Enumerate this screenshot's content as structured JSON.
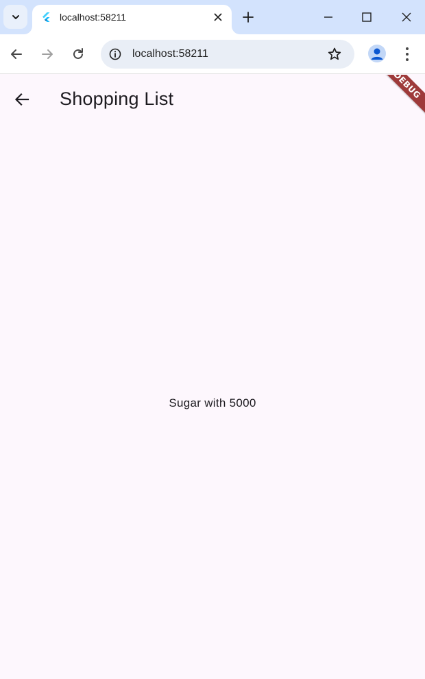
{
  "browser": {
    "tab": {
      "title": "localhost:58211"
    },
    "address_bar": {
      "url": "localhost:58211"
    }
  },
  "app": {
    "title": "Shopping List",
    "body_text": "Sugar with 5000",
    "debug_banner": "DEBUG"
  },
  "colors": {
    "tabstrip": "#d3e3fd",
    "app_background": "#fdf7fd",
    "debug_ribbon": "#9e3a3a",
    "text": "#1d1b20"
  }
}
